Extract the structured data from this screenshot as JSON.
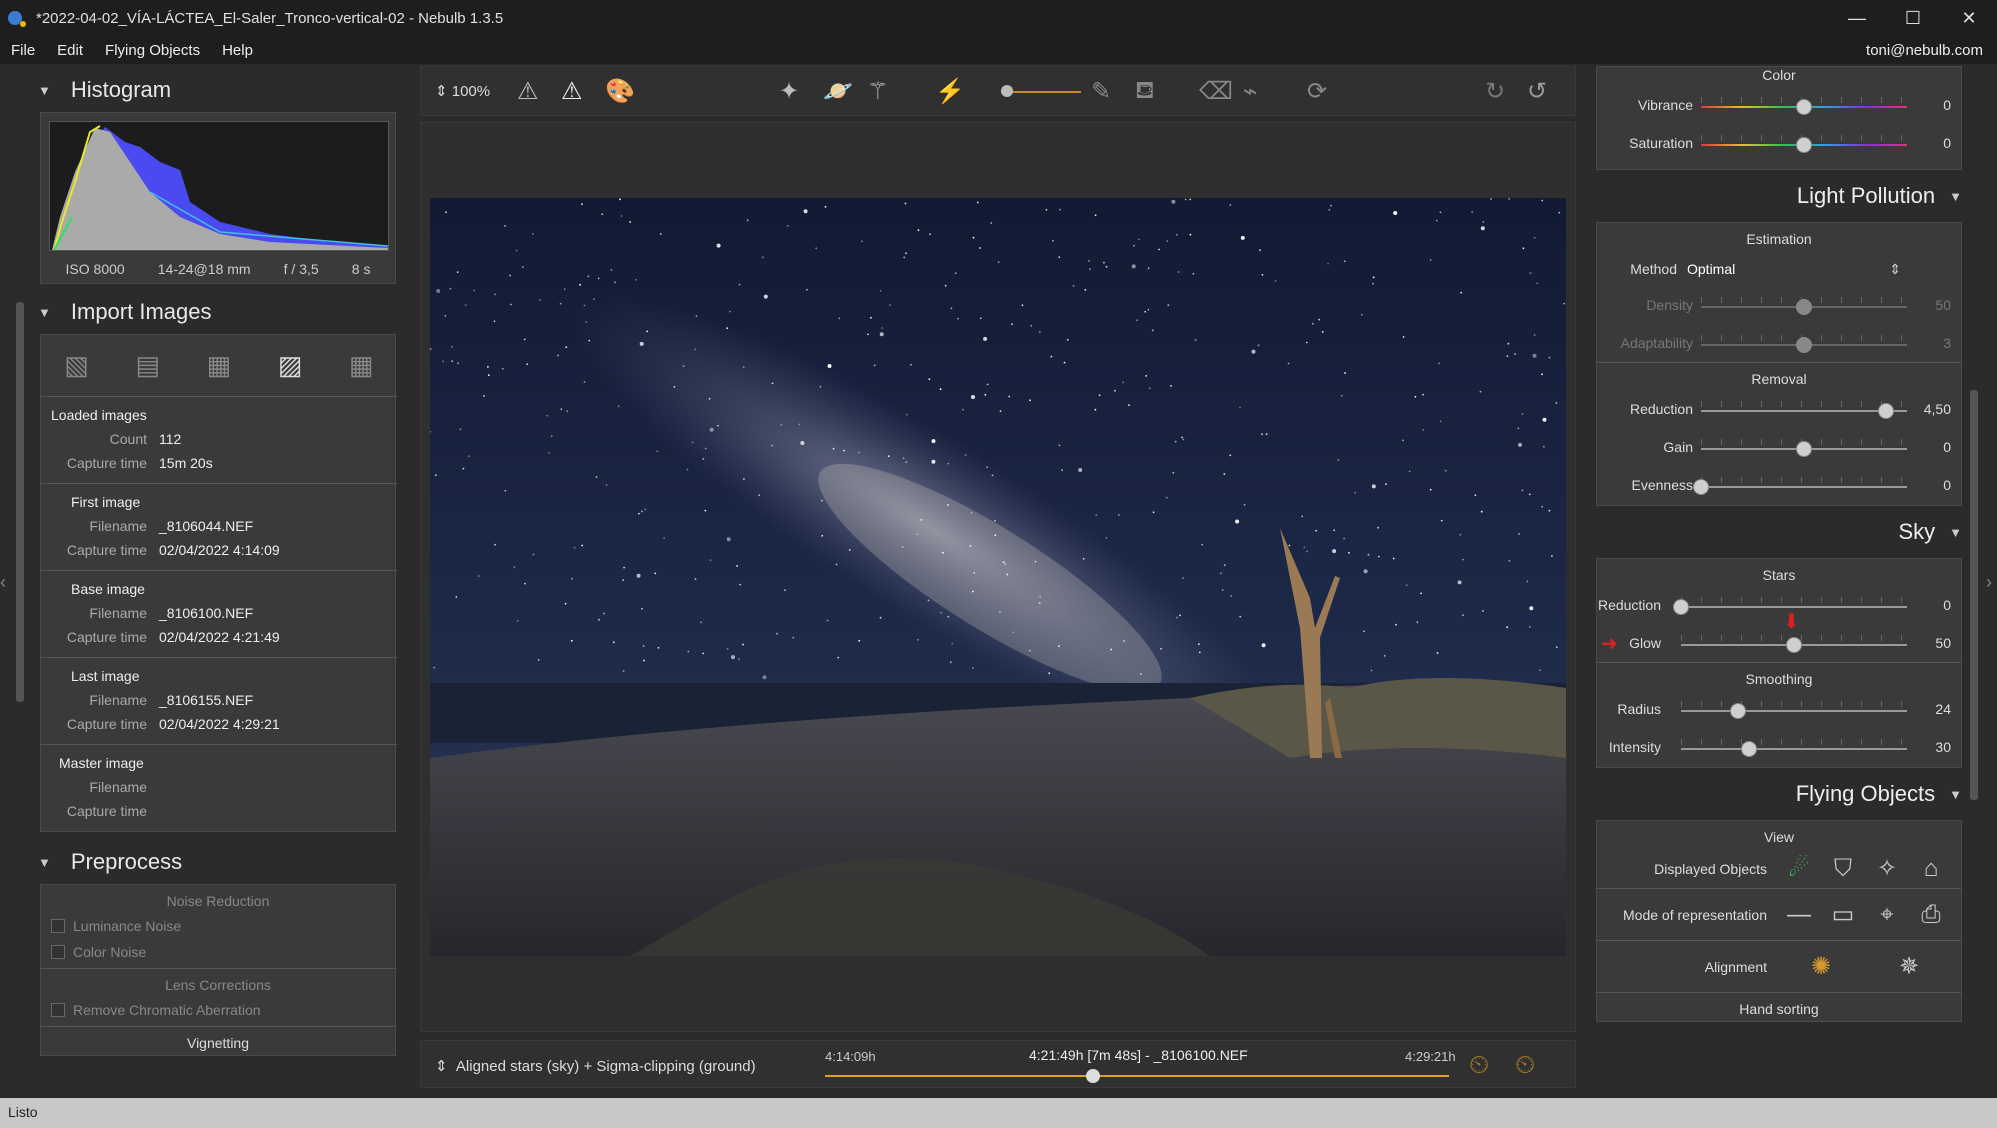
{
  "window": {
    "title": "*2022-04-02_VÍA-LÁCTEA_El-Saler_Tronco-vertical-02 - Nebulb 1.3.5",
    "minimize": "—",
    "maximize": "☐",
    "close": "✕"
  },
  "menu": {
    "items": [
      "File",
      "Edit",
      "Flying Objects",
      "Help"
    ],
    "user": "toni@nebulb.com"
  },
  "histogram": {
    "title": "Histogram",
    "iso": "ISO 8000",
    "lens": "14-24@18 mm",
    "aperture": "f / 3,5",
    "exposure": "8 s"
  },
  "import": {
    "title": "Import Images",
    "loaded": {
      "heading": "Loaded images",
      "count_label": "Count",
      "count": "112",
      "capture_label": "Capture time",
      "capture": "15m 20s"
    },
    "first": {
      "heading": "First image",
      "filename_label": "Filename",
      "filename": "_8106044.NEF",
      "capture_label": "Capture time",
      "capture": "02/04/2022 4:14:09"
    },
    "base": {
      "heading": "Base image",
      "filename_label": "Filename",
      "filename": "_8106100.NEF",
      "capture_label": "Capture time",
      "capture": "02/04/2022 4:21:49"
    },
    "last": {
      "heading": "Last image",
      "filename_label": "Filename",
      "filename": "_8106155.NEF",
      "capture_label": "Capture time",
      "capture": "02/04/2022 4:29:21"
    },
    "master": {
      "heading": "Master image",
      "filename_label": "Filename",
      "capture_label": "Capture time"
    }
  },
  "preprocess": {
    "title": "Preprocess",
    "noise_reduction": "Noise Reduction",
    "luminance_noise": "Luminance Noise",
    "color_noise": "Color Noise",
    "lens_corrections": "Lens Corrections",
    "remove_ca": "Remove Chromatic Aberration",
    "vignetting": "Vignetting"
  },
  "toolbar": {
    "zoom": "100%"
  },
  "bottom": {
    "mode": "Aligned stars (sky) + Sigma-clipping (ground)",
    "start_time": "4:14:09h",
    "current": "4:21:49h [7m 48s] - _8106100.NEF",
    "end_time": "4:29:21h",
    "position": 0.43
  },
  "color": {
    "title": "Color",
    "vibrance": {
      "label": "Vibrance",
      "value": "0",
      "pos": 0.5
    },
    "saturation": {
      "label": "Saturation",
      "value": "0",
      "pos": 0.5
    }
  },
  "light_pollution": {
    "title": "Light Pollution",
    "estimation": "Estimation",
    "method_label": "Method",
    "method_value": "Optimal",
    "density": {
      "label": "Density",
      "value": "50",
      "pos": 0.5
    },
    "adaptability": {
      "label": "Adaptability",
      "value": "3",
      "pos": 0.5
    },
    "removal": "Removal",
    "reduction": {
      "label": "Reduction",
      "value": "4,50",
      "pos": 0.9
    },
    "gain": {
      "label": "Gain",
      "value": "0",
      "pos": 0.5
    },
    "evenness": {
      "label": "Evenness",
      "value": "0",
      "pos": 0.0
    }
  },
  "sky": {
    "title": "Sky",
    "stars": "Stars",
    "reduction": {
      "label": "Reduction",
      "value": "0",
      "pos": 0.0
    },
    "glow": {
      "label": "Glow",
      "value": "50",
      "pos": 0.5
    },
    "smoothing": "Smoothing",
    "radius": {
      "label": "Radius",
      "value": "24",
      "pos": 0.25
    },
    "intensity": {
      "label": "Intensity",
      "value": "30",
      "pos": 0.3
    }
  },
  "flying": {
    "title": "Flying Objects",
    "view": "View",
    "displayed": "Displayed Objects",
    "mode": "Mode of representation",
    "alignment": "Alignment",
    "hand_sorting": "Hand sorting"
  },
  "status": {
    "text": "Listo"
  }
}
